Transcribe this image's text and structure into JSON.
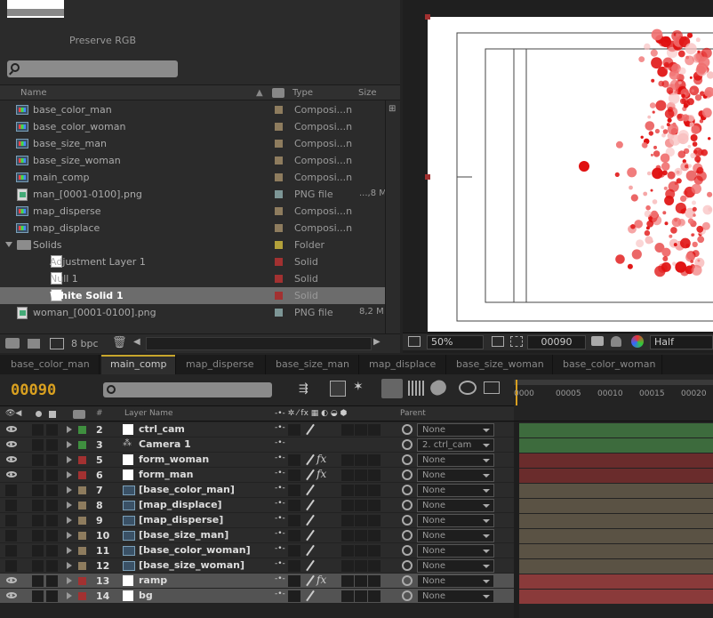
{
  "project": {
    "preserve_rgb": "Preserve RGB",
    "search_placeholder": "",
    "columns": {
      "name": "Name",
      "type": "Type",
      "size": "Size"
    },
    "items": [
      {
        "name": "base_color_man",
        "kind": "comp",
        "type": "Composi...n",
        "size": "",
        "label_color": "#8e7c5e",
        "indent": 0
      },
      {
        "name": "base_color_woman",
        "kind": "comp",
        "type": "Composi...n",
        "size": "",
        "label_color": "#8e7c5e",
        "indent": 0
      },
      {
        "name": "base_size_man",
        "kind": "comp",
        "type": "Composi...n",
        "size": "",
        "label_color": "#8e7c5e",
        "indent": 0
      },
      {
        "name": "base_size_woman",
        "kind": "comp",
        "type": "Composi...n",
        "size": "",
        "label_color": "#8e7c5e",
        "indent": 0
      },
      {
        "name": "main_comp",
        "kind": "comp",
        "type": "Composi...n",
        "size": "",
        "label_color": "#8e7c5e",
        "indent": 0
      },
      {
        "name": "man_[0001-0100].png",
        "kind": "png",
        "type": "PNG file",
        "size": "...,8 M",
        "label_color": "#7d9696",
        "indent": 0
      },
      {
        "name": "map_disperse",
        "kind": "comp",
        "type": "Composi...n",
        "size": "",
        "label_color": "#8e7c5e",
        "indent": 0
      },
      {
        "name": "map_displace",
        "kind": "comp",
        "type": "Composi...n",
        "size": "",
        "label_color": "#8e7c5e",
        "indent": 0
      },
      {
        "name": "Solids",
        "kind": "folder",
        "type": "Folder",
        "size": "",
        "label_color": "#b3a13a",
        "indent": 0
      },
      {
        "name": "Adjustment Layer 1",
        "kind": "solid",
        "type": "Solid",
        "size": "",
        "label_color": "#a23131",
        "indent": 1
      },
      {
        "name": "Null 1",
        "kind": "solid",
        "type": "Solid",
        "size": "",
        "label_color": "#a23131",
        "indent": 1
      },
      {
        "name": "White Solid 1",
        "kind": "solid",
        "type": "Solid",
        "size": "",
        "label_color": "#a23131",
        "indent": 1,
        "selected": true
      },
      {
        "name": "woman_[0001-0100].png",
        "kind": "png",
        "type": "PNG file",
        "size": "8,2 M",
        "label_color": "#7d9696",
        "indent": 0
      }
    ],
    "footer": {
      "bpc": "8 bpc"
    }
  },
  "viewer": {
    "zoom": "50%",
    "timecode": "00090",
    "resolution": "Half"
  },
  "timeline": {
    "tabs": [
      "base_color_man",
      "main_comp",
      "map_disperse",
      "base_size_man",
      "map_displace",
      "base_size_woman",
      "base_color_woman"
    ],
    "active_tab": "main_comp",
    "timecode": "00090",
    "ruler_ticks": [
      "0000",
      "00005",
      "00010",
      "00015",
      "00020"
    ],
    "headers": {
      "number": "#",
      "layer_name": "Layer Name",
      "parent": "Parent"
    },
    "layers": [
      {
        "num": "2",
        "name": "ctrl_cam",
        "type": "solid",
        "color": "#3f8f3f",
        "parent": "None",
        "eye": true,
        "fx": false,
        "selected": false,
        "bar": "#3d6b3d"
      },
      {
        "num": "3",
        "name": "Camera 1",
        "type": "camera",
        "color": "#3f8f3f",
        "parent": "2. ctrl_cam",
        "eye": true,
        "fx": false,
        "selected": false,
        "bar": "#3d6b3d"
      },
      {
        "num": "5",
        "name": "form_woman",
        "type": "solid",
        "color": "#a23131",
        "parent": "None",
        "eye": true,
        "fx": true,
        "selected": false,
        "bar": "#6a2c2c"
      },
      {
        "num": "6",
        "name": "form_man",
        "type": "solid",
        "color": "#a23131",
        "parent": "None",
        "eye": true,
        "fx": true,
        "selected": false,
        "bar": "#6a2c2c"
      },
      {
        "num": "7",
        "name": "[base_color_man]",
        "type": "comp",
        "color": "#8e7c5e",
        "parent": "None",
        "eye": false,
        "fx": false,
        "selected": false,
        "bar": "#5a5244"
      },
      {
        "num": "8",
        "name": "[map_displace]",
        "type": "comp",
        "color": "#8e7c5e",
        "parent": "None",
        "eye": false,
        "fx": false,
        "selected": false,
        "bar": "#5a5244"
      },
      {
        "num": "9",
        "name": "[map_disperse]",
        "type": "comp",
        "color": "#8e7c5e",
        "parent": "None",
        "eye": false,
        "fx": false,
        "selected": false,
        "bar": "#5a5244"
      },
      {
        "num": "10",
        "name": "[base_size_man]",
        "type": "comp",
        "color": "#8e7c5e",
        "parent": "None",
        "eye": false,
        "fx": false,
        "selected": false,
        "bar": "#5a5244"
      },
      {
        "num": "11",
        "name": "[base_color_woman]",
        "type": "comp",
        "color": "#8e7c5e",
        "parent": "None",
        "eye": false,
        "fx": false,
        "selected": false,
        "bar": "#5a5244"
      },
      {
        "num": "12",
        "name": "[base_size_woman]",
        "type": "comp",
        "color": "#8e7c5e",
        "parent": "None",
        "eye": false,
        "fx": false,
        "selected": false,
        "bar": "#5a5244"
      },
      {
        "num": "13",
        "name": "ramp",
        "type": "solid",
        "color": "#a23131",
        "parent": "None",
        "eye": true,
        "fx": true,
        "selected": true,
        "bar": "#8a3a3a"
      },
      {
        "num": "14",
        "name": "bg",
        "type": "solid",
        "color": "#a23131",
        "parent": "None",
        "eye": true,
        "fx": false,
        "selected": true,
        "bar": "#8a3a3a"
      }
    ]
  }
}
